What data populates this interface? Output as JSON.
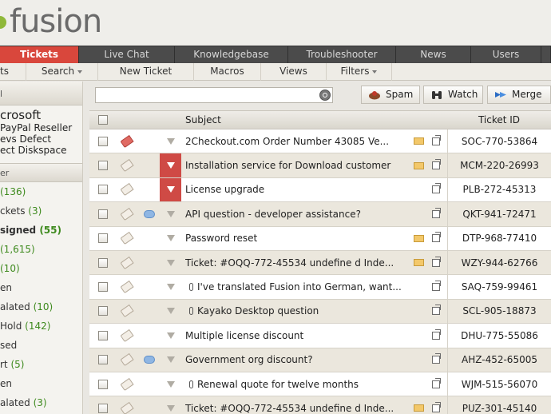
{
  "app": {
    "logo_text": "fusion"
  },
  "main_nav": [
    {
      "label": "Tickets",
      "active": true
    },
    {
      "label": "Live Chat"
    },
    {
      "label": "Knowledgebase"
    },
    {
      "label": "Troubleshooter"
    },
    {
      "label": "News"
    },
    {
      "label": "Users"
    }
  ],
  "sub_nav": {
    "tickets_label": "ts",
    "search_label": "Search",
    "new_ticket_label": "New Ticket",
    "macros_label": "Macros",
    "views_label": "Views",
    "filters_label": "Filters"
  },
  "sidebar": {
    "header1": "l",
    "org_name": "crosoft",
    "org_line1": "PayPal Reseller",
    "org_line2": "evs Defect",
    "org_line3": "ect Diskspace",
    "header2": "er",
    "views": [
      {
        "label": "",
        "count": "(136)",
        "bold": false
      },
      {
        "label": "ckets",
        "count": "(3)",
        "bold": false
      },
      {
        "label": "signed",
        "count": "(55)",
        "bold": true
      },
      {
        "label": "",
        "count": "(1,615)",
        "bold": false
      },
      {
        "label": "",
        "count": "(10)",
        "bold": false
      },
      {
        "label": "en",
        "count": "",
        "bold": false
      },
      {
        "label": "alated",
        "count": "(10)",
        "bold": false
      },
      {
        "label": "Hold",
        "count": "(142)",
        "bold": false
      },
      {
        "label": "sed",
        "count": "",
        "bold": false
      },
      {
        "label": "rt",
        "count": "(5)",
        "bold": false
      },
      {
        "label": "en",
        "count": "",
        "bold": false
      },
      {
        "label": "alated",
        "count": "(3)",
        "bold": false
      }
    ]
  },
  "toolbar": {
    "search_placeholder": "",
    "spam_label": "Spam",
    "watch_label": "Watch",
    "merge_label": "Merge"
  },
  "grid": {
    "subject_header": "Subject",
    "id_header": "Ticket ID",
    "rows": [
      {
        "subject": "2Checkout.com Order Number 43085 Ve...",
        "id": "SOC-770-53864",
        "hot": true,
        "chat": false,
        "flag_red": false,
        "mail": true,
        "attach": false
      },
      {
        "subject": "Installation service for Download customer",
        "id": "MCM-220-26993",
        "hot": false,
        "chat": false,
        "flag_red": true,
        "mail": true,
        "attach": false
      },
      {
        "subject": "License upgrade",
        "id": "PLB-272-45313",
        "hot": false,
        "chat": false,
        "flag_red": true,
        "mail": false,
        "attach": false
      },
      {
        "subject": "API question - developer assistance?",
        "id": "QKT-941-72471",
        "hot": false,
        "chat": true,
        "flag_red": false,
        "mail": false,
        "attach": false
      },
      {
        "subject": "Password reset",
        "id": "DTP-968-77410",
        "hot": false,
        "chat": false,
        "flag_red": false,
        "mail": true,
        "attach": false
      },
      {
        "subject": "Ticket: #OQQ-772-45534 undefine d Inde...",
        "id": "WZY-944-62766",
        "hot": false,
        "chat": false,
        "flag_red": false,
        "mail": true,
        "attach": false
      },
      {
        "subject": "I've translated Fusion into German, want...",
        "id": "SAQ-759-99461",
        "hot": false,
        "chat": false,
        "flag_red": false,
        "mail": false,
        "attach": true
      },
      {
        "subject": "Kayako Desktop question",
        "id": "SCL-905-18873",
        "hot": false,
        "chat": false,
        "flag_red": false,
        "mail": false,
        "attach": true
      },
      {
        "subject": "Multiple license discount",
        "id": "DHU-775-55086",
        "hot": false,
        "chat": false,
        "flag_red": false,
        "mail": false,
        "attach": false
      },
      {
        "subject": "Government org discount?",
        "id": "AHZ-452-65005",
        "hot": false,
        "chat": true,
        "flag_red": false,
        "mail": false,
        "attach": false
      },
      {
        "subject": "Renewal quote for twelve months",
        "id": "WJM-515-56070",
        "hot": false,
        "chat": false,
        "flag_red": false,
        "mail": false,
        "attach": true
      },
      {
        "subject": "Ticket: #OQQ-772-45534 undefine d Inde...",
        "id": "PUZ-301-45140",
        "hot": false,
        "chat": false,
        "flag_red": false,
        "mail": true,
        "attach": false
      }
    ]
  }
}
